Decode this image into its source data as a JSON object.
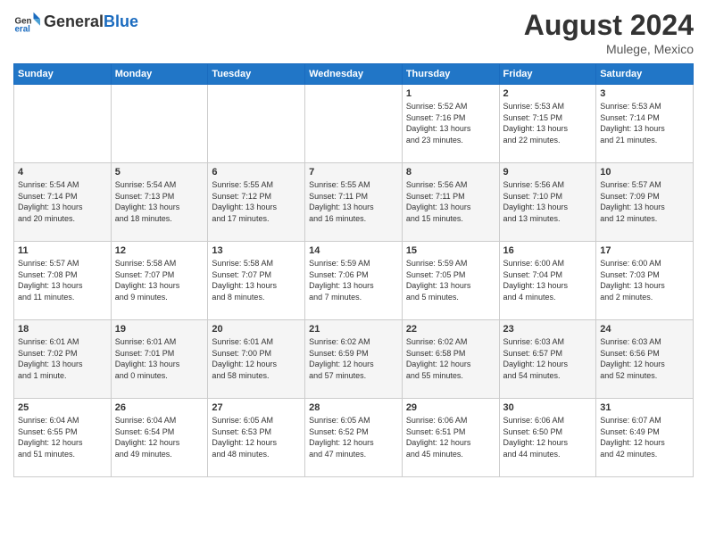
{
  "header": {
    "logo_general": "General",
    "logo_blue": "Blue",
    "month_year": "August 2024",
    "location": "Mulege, Mexico"
  },
  "days_of_week": [
    "Sunday",
    "Monday",
    "Tuesday",
    "Wednesday",
    "Thursday",
    "Friday",
    "Saturday"
  ],
  "weeks": [
    [
      {
        "day": "",
        "info": ""
      },
      {
        "day": "",
        "info": ""
      },
      {
        "day": "",
        "info": ""
      },
      {
        "day": "",
        "info": ""
      },
      {
        "day": "1",
        "info": "Sunrise: 5:52 AM\nSunset: 7:16 PM\nDaylight: 13 hours\nand 23 minutes."
      },
      {
        "day": "2",
        "info": "Sunrise: 5:53 AM\nSunset: 7:15 PM\nDaylight: 13 hours\nand 22 minutes."
      },
      {
        "day": "3",
        "info": "Sunrise: 5:53 AM\nSunset: 7:14 PM\nDaylight: 13 hours\nand 21 minutes."
      }
    ],
    [
      {
        "day": "4",
        "info": "Sunrise: 5:54 AM\nSunset: 7:14 PM\nDaylight: 13 hours\nand 20 minutes."
      },
      {
        "day": "5",
        "info": "Sunrise: 5:54 AM\nSunset: 7:13 PM\nDaylight: 13 hours\nand 18 minutes."
      },
      {
        "day": "6",
        "info": "Sunrise: 5:55 AM\nSunset: 7:12 PM\nDaylight: 13 hours\nand 17 minutes."
      },
      {
        "day": "7",
        "info": "Sunrise: 5:55 AM\nSunset: 7:11 PM\nDaylight: 13 hours\nand 16 minutes."
      },
      {
        "day": "8",
        "info": "Sunrise: 5:56 AM\nSunset: 7:11 PM\nDaylight: 13 hours\nand 15 minutes."
      },
      {
        "day": "9",
        "info": "Sunrise: 5:56 AM\nSunset: 7:10 PM\nDaylight: 13 hours\nand 13 minutes."
      },
      {
        "day": "10",
        "info": "Sunrise: 5:57 AM\nSunset: 7:09 PM\nDaylight: 13 hours\nand 12 minutes."
      }
    ],
    [
      {
        "day": "11",
        "info": "Sunrise: 5:57 AM\nSunset: 7:08 PM\nDaylight: 13 hours\nand 11 minutes."
      },
      {
        "day": "12",
        "info": "Sunrise: 5:58 AM\nSunset: 7:07 PM\nDaylight: 13 hours\nand 9 minutes."
      },
      {
        "day": "13",
        "info": "Sunrise: 5:58 AM\nSunset: 7:07 PM\nDaylight: 13 hours\nand 8 minutes."
      },
      {
        "day": "14",
        "info": "Sunrise: 5:59 AM\nSunset: 7:06 PM\nDaylight: 13 hours\nand 7 minutes."
      },
      {
        "day": "15",
        "info": "Sunrise: 5:59 AM\nSunset: 7:05 PM\nDaylight: 13 hours\nand 5 minutes."
      },
      {
        "day": "16",
        "info": "Sunrise: 6:00 AM\nSunset: 7:04 PM\nDaylight: 13 hours\nand 4 minutes."
      },
      {
        "day": "17",
        "info": "Sunrise: 6:00 AM\nSunset: 7:03 PM\nDaylight: 13 hours\nand 2 minutes."
      }
    ],
    [
      {
        "day": "18",
        "info": "Sunrise: 6:01 AM\nSunset: 7:02 PM\nDaylight: 13 hours\nand 1 minute."
      },
      {
        "day": "19",
        "info": "Sunrise: 6:01 AM\nSunset: 7:01 PM\nDaylight: 13 hours\nand 0 minutes."
      },
      {
        "day": "20",
        "info": "Sunrise: 6:01 AM\nSunset: 7:00 PM\nDaylight: 12 hours\nand 58 minutes."
      },
      {
        "day": "21",
        "info": "Sunrise: 6:02 AM\nSunset: 6:59 PM\nDaylight: 12 hours\nand 57 minutes."
      },
      {
        "day": "22",
        "info": "Sunrise: 6:02 AM\nSunset: 6:58 PM\nDaylight: 12 hours\nand 55 minutes."
      },
      {
        "day": "23",
        "info": "Sunrise: 6:03 AM\nSunset: 6:57 PM\nDaylight: 12 hours\nand 54 minutes."
      },
      {
        "day": "24",
        "info": "Sunrise: 6:03 AM\nSunset: 6:56 PM\nDaylight: 12 hours\nand 52 minutes."
      }
    ],
    [
      {
        "day": "25",
        "info": "Sunrise: 6:04 AM\nSunset: 6:55 PM\nDaylight: 12 hours\nand 51 minutes."
      },
      {
        "day": "26",
        "info": "Sunrise: 6:04 AM\nSunset: 6:54 PM\nDaylight: 12 hours\nand 49 minutes."
      },
      {
        "day": "27",
        "info": "Sunrise: 6:05 AM\nSunset: 6:53 PM\nDaylight: 12 hours\nand 48 minutes."
      },
      {
        "day": "28",
        "info": "Sunrise: 6:05 AM\nSunset: 6:52 PM\nDaylight: 12 hours\nand 47 minutes."
      },
      {
        "day": "29",
        "info": "Sunrise: 6:06 AM\nSunset: 6:51 PM\nDaylight: 12 hours\nand 45 minutes."
      },
      {
        "day": "30",
        "info": "Sunrise: 6:06 AM\nSunset: 6:50 PM\nDaylight: 12 hours\nand 44 minutes."
      },
      {
        "day": "31",
        "info": "Sunrise: 6:07 AM\nSunset: 6:49 PM\nDaylight: 12 hours\nand 42 minutes."
      }
    ]
  ]
}
